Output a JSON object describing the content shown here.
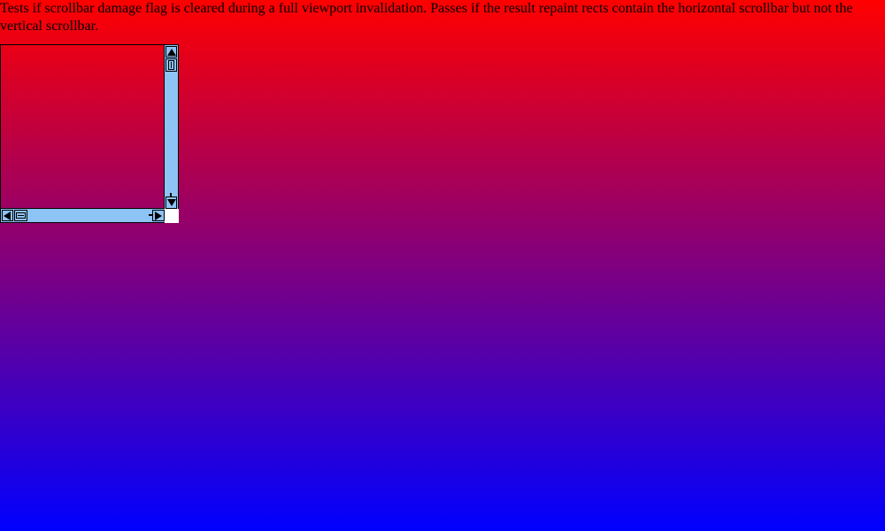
{
  "description": {
    "text": "Tests if scrollbar damage flag is cleared during a full viewport invalidation. Passes if the result repaint rects contain the horizontal scrollbar but not the vertical scrollbar."
  },
  "colors": {
    "gradient_top": "#ff0000",
    "gradient_bottom": "#0000ff",
    "scrollbar_track": "#8ec3f5",
    "scrollbar_border": "#000000",
    "corner": "#ffffff"
  },
  "icons": {
    "scroll_up": "triangle-up-icon",
    "scroll_down": "triangle-down-icon",
    "scroll_left": "triangle-left-icon",
    "scroll_right": "triangle-right-icon",
    "v_thumb_grip": "vertical-grip-icon",
    "h_thumb_grip": "horizontal-grip-icon"
  }
}
